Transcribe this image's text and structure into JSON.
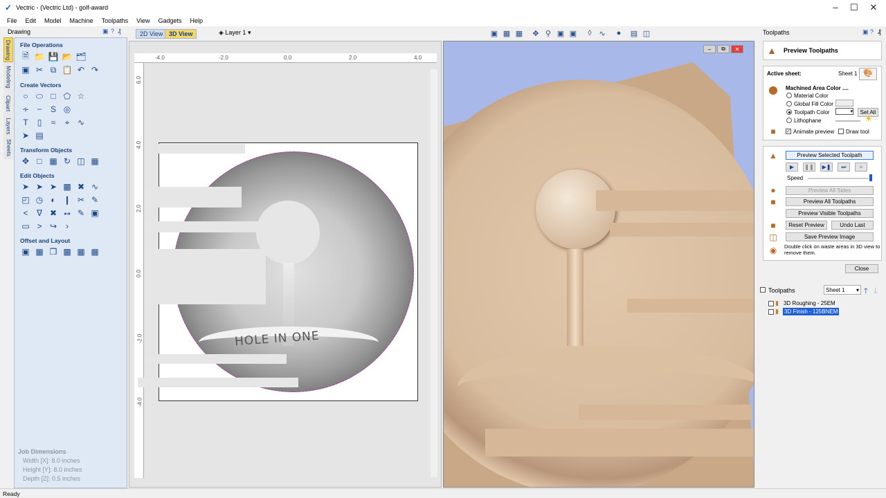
{
  "window": {
    "title": "Vectric - (Vectric Ltd) - golf-award",
    "app_icon": "vectric-logo-icon"
  },
  "menu": [
    "File",
    "Edit",
    "Model",
    "Machine",
    "Toolpaths",
    "View",
    "Gadgets",
    "Help"
  ],
  "left_panel": {
    "title": "Drawing",
    "vertical_tabs": [
      "Drawing",
      "Modeling",
      "Clipart",
      "Layers",
      "Sheets"
    ],
    "sections": {
      "file_ops": "File Operations",
      "create_vectors": "Create Vectors",
      "transform": "Transform Objects",
      "edit": "Edit Objects",
      "offset": "Offset and Layout"
    },
    "job": {
      "title": "Job Dimensions",
      "width": "Width  [X]: 8.0 inches",
      "height": "Height [Y]: 8.0 inches",
      "depth": "Depth  [Z]: 0.5 inches"
    }
  },
  "view_tabs": {
    "tab_2d": "2D View",
    "tab_3d": "3D View",
    "layer": "Layer 1"
  },
  "view2d": {
    "ruler_x": [
      "-4.0",
      "-2.0",
      "0.0",
      "2.0",
      "4.0"
    ],
    "ruler_y": [
      "6.0",
      "4.0",
      "2.0",
      "0.0",
      "-2.0",
      "-4.0"
    ],
    "banner_text": "HOLE IN ONE"
  },
  "right_panel": {
    "title": "Toolpaths",
    "preview_title": "Preview Toolpaths",
    "active_sheet_label": "Active sheet:",
    "active_sheet_value": "Sheet 1",
    "machined_area_label": "Machined Area Color ....",
    "options": {
      "material": "Material Color",
      "global_fill": "Global Fill Color",
      "toolpath": "Toolpath Color",
      "lithophane": "Lithophane"
    },
    "set_all": "Set All",
    "animate_preview": "Animate preview",
    "draw_tool": "Draw tool",
    "preview_selected": "Preview Selected Toolpath",
    "speed_label": "Speed",
    "preview_all_sides": "Preview All Sides",
    "preview_all_toolpaths": "Preview All Toolpaths",
    "preview_visible": "Preview Visible Toolpaths",
    "reset_preview": "Reset Preview",
    "undo_last": "Undo Last",
    "save_preview": "Save Preview Image",
    "hint": "Double click on waste areas in 3D view to remove them.",
    "close": "Close",
    "toolpaths_list_title": "Toolpaths",
    "sheet_select": "Sheet 1",
    "toolpaths": [
      "3D Roughing - 25EM",
      "3D Finish - 125BNEM"
    ]
  },
  "status": "Ready"
}
